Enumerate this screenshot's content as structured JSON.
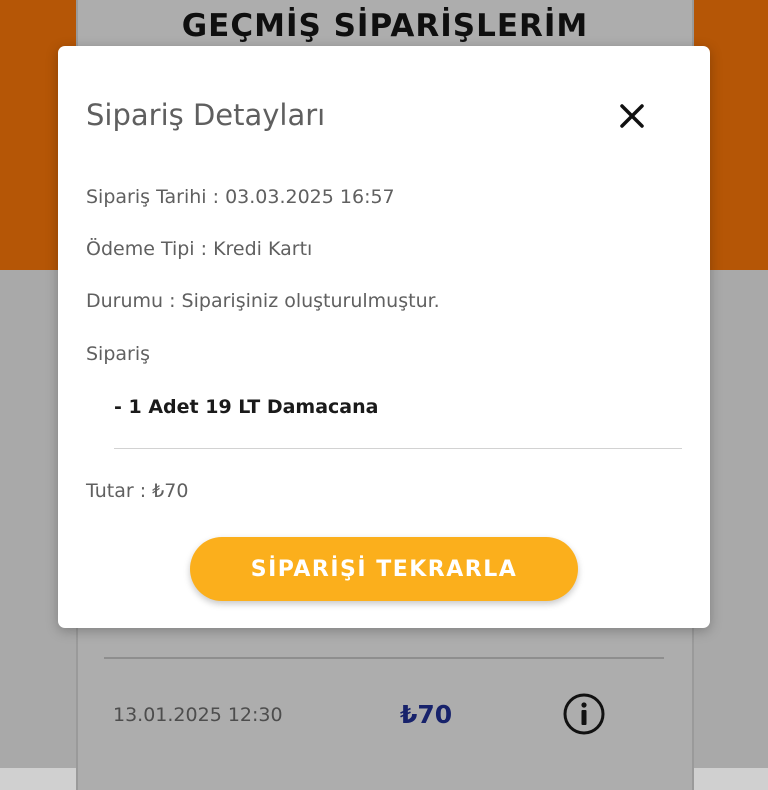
{
  "background": {
    "page_title": "GEÇMİŞ SİPARİŞLERİM",
    "order_row": {
      "date": "13.01.2025 12:30",
      "amount": "₺70"
    },
    "info_icon": "info-circle-icon"
  },
  "modal": {
    "title": "Sipariş Detayları",
    "close_icon": "close-icon",
    "order_date": "Sipariş Tarihi : 03.03.2025 16:57",
    "payment_type": "Ödeme Tipi : Kredi Kartı",
    "status": "Durumu : Siparişiniz oluşturulmuştur.",
    "order_label": "Sipariş",
    "order_items": [
      "- 1 Adet 19 LT Damacana"
    ],
    "total": "Tutar : ₺70",
    "reorder_button": "SİPARİŞİ TEKRARLA"
  },
  "colors": {
    "orange_header": "#b55606",
    "button_accent": "#fbaf1c",
    "amount_text": "#17226b"
  }
}
